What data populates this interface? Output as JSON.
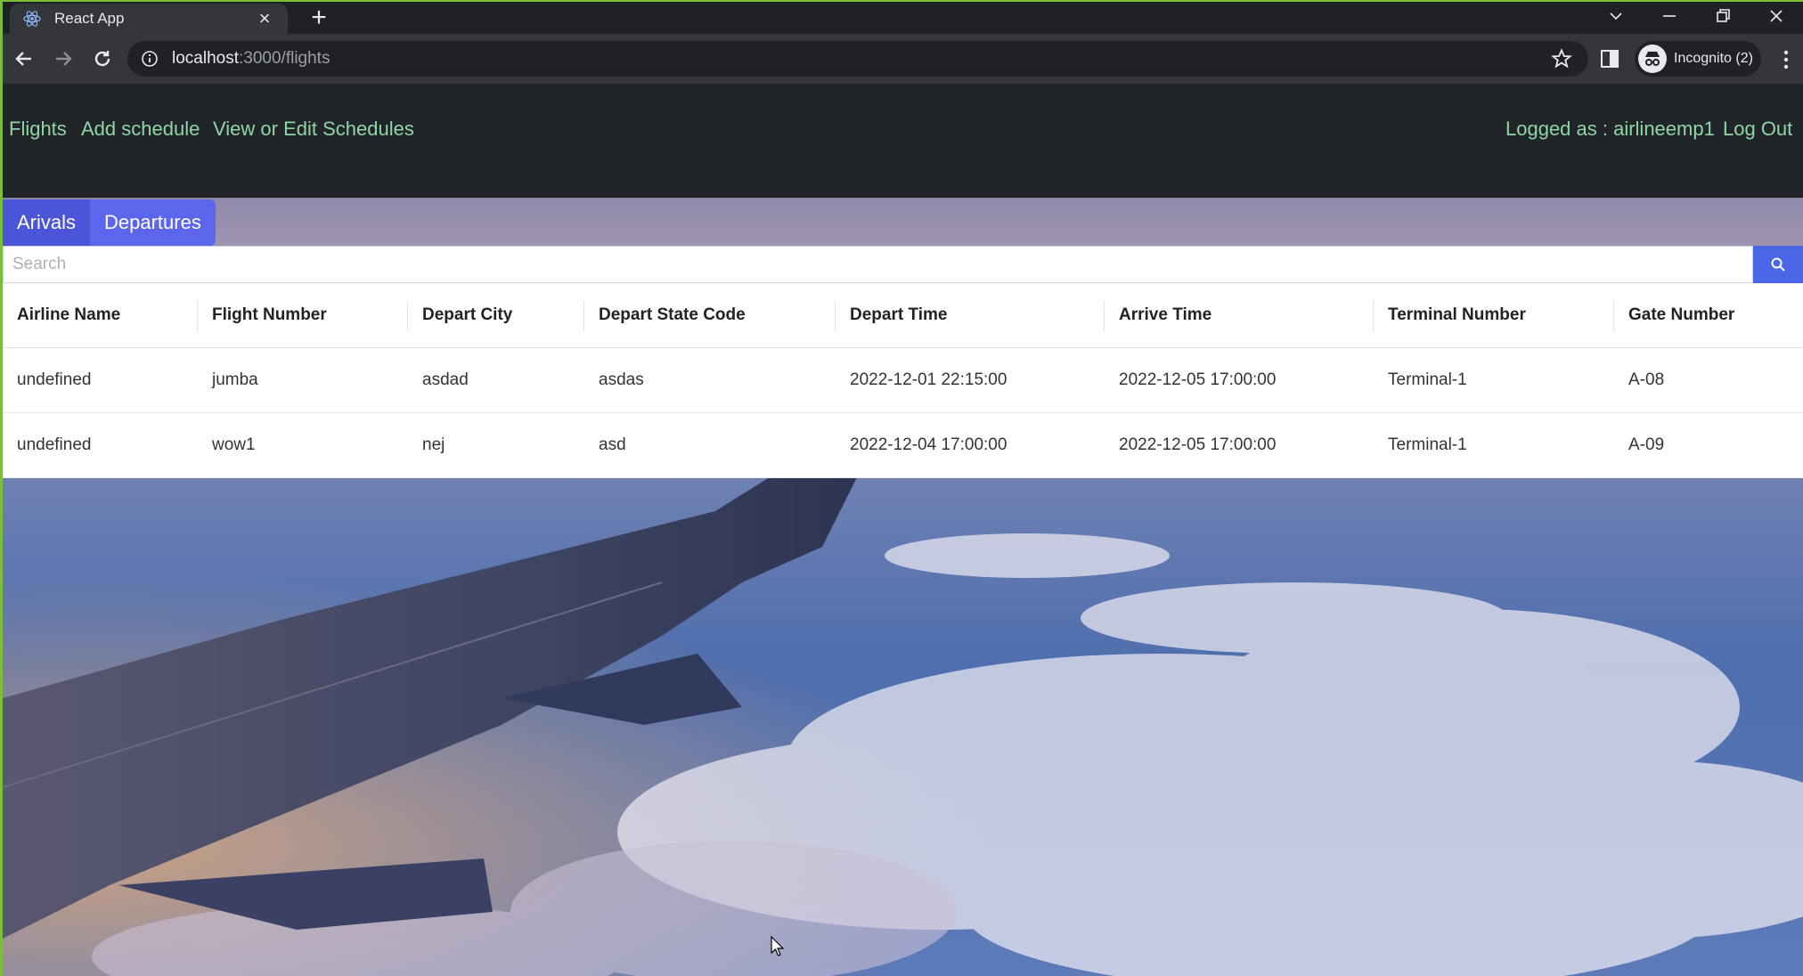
{
  "browser": {
    "tab_title": "React App",
    "url_host": "localhost",
    "url_path": ":3000/flights",
    "profile_label": "Incognito (2)"
  },
  "nav": {
    "links": [
      "Flights",
      "Add schedule",
      "View or Edit Schedules"
    ],
    "logged_as": "Logged as : airlineemp1",
    "logout": "Log Out"
  },
  "view_tabs": {
    "arrivals": "Arivals",
    "departures": "Departures"
  },
  "search": {
    "placeholder": "Search",
    "value": ""
  },
  "table": {
    "headers": [
      "Airline Name",
      "Flight Number",
      "Depart City",
      "Depart State Code",
      "Depart Time",
      "Arrive Time",
      "Terminal Number",
      "Gate Number"
    ],
    "rows": [
      [
        "undefined",
        "jumba",
        "asdad",
        "asdas",
        "2022-12-01 22:15:00",
        "2022-12-05 17:00:00",
        "Terminal-1",
        "A-08"
      ],
      [
        "undefined",
        "wow1",
        "nej",
        "asd",
        "2022-12-04 17:00:00",
        "2022-12-05 17:00:00",
        "Terminal-1",
        "A-09"
      ]
    ]
  },
  "colors": {
    "nav_bg": "#212529",
    "nav_link": "#8fd5a6",
    "tab_active": "#4b55d8",
    "search_button": "#4b66e6"
  },
  "icons": [
    "react-favicon-icon",
    "close-icon",
    "plus-icon",
    "back-icon",
    "forward-icon",
    "reload-icon",
    "info-icon",
    "star-icon",
    "side-panel-icon",
    "incognito-icon",
    "kebab-menu-icon",
    "search-icon"
  ]
}
